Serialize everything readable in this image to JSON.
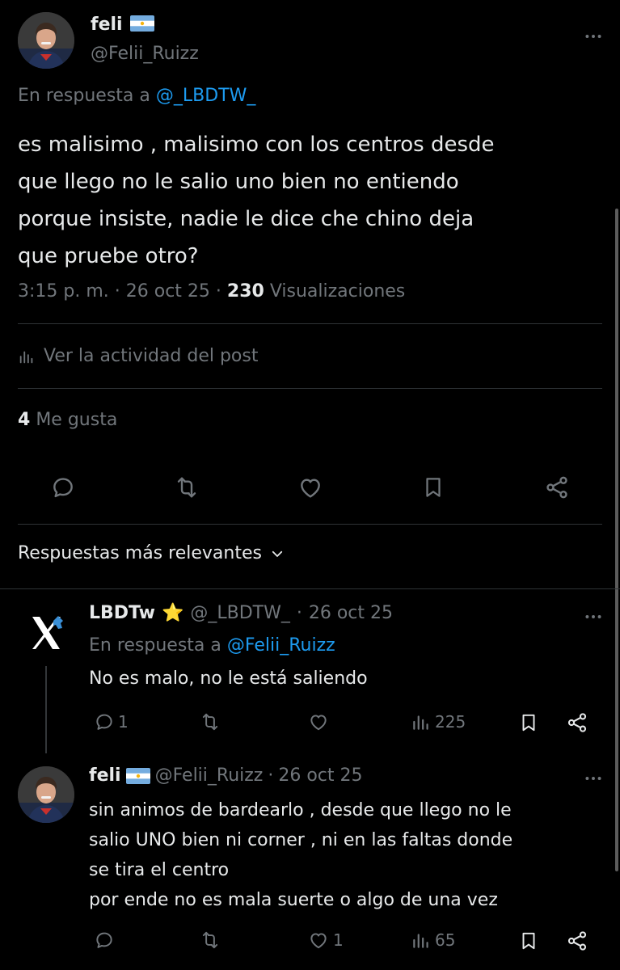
{
  "main_post": {
    "display_name": "feli",
    "handle": "@Felii_Ruizz",
    "reply_prefix": "En respuesta a",
    "reply_to": "@_LBDTW_",
    "text_lines": [
      "es malisimo , malisimo con los centros  desde",
      "que llego no le salio uno bien no entiendo",
      "porque insiste, nadie le dice che chino deja",
      "que pruebe otro?"
    ],
    "time": "3:15 p. m.",
    "date": "26 oct 25",
    "views_count": "230",
    "views_label": "Visualizaciones",
    "activity_label": "Ver la actividad del post",
    "likes_count": "4",
    "likes_label": "Me gusta"
  },
  "replies_header": {
    "label": "Respuestas más relevantes"
  },
  "replies": [
    {
      "display_name": "LBDTw",
      "badge": "⭐",
      "handle": "@_LBDTW_",
      "date": "26 oct 25",
      "reply_prefix": "En respuesta a",
      "reply_to": "@Felii_Ruizz",
      "text_lines": [
        "No es malo, no le está saliendo"
      ],
      "reply_count": "1",
      "retweet_count": "",
      "like_count": "",
      "views_count": "225"
    },
    {
      "display_name": "feli",
      "handle": "@Felii_Ruizz",
      "date": "26 oct 25",
      "text_lines": [
        "sin animos de bardearlo , desde que llego no le",
        "salio UNO bien ni corner , ni en las faltas donde",
        "se tira el centro",
        "por ende no es mala suerte o algo de una vez"
      ],
      "reply_count": "",
      "retweet_count": "",
      "like_count": "1",
      "views_count": "65"
    }
  ],
  "icons": {
    "more": "more-horizontal-icon",
    "reply": "reply-icon",
    "retweet": "retweet-icon",
    "like": "heart-icon",
    "bookmark": "bookmark-icon",
    "share": "share-icon",
    "views": "views-bar-chart-icon",
    "chevron": "chevron-down-icon",
    "flag": "argentina-flag-icon",
    "x_logo": "x-logo-icon"
  },
  "colors": {
    "background": "#000000",
    "text": "#e7e9ea",
    "muted": "#71767b",
    "link": "#1d9bf0",
    "divider": "#2f3336"
  }
}
